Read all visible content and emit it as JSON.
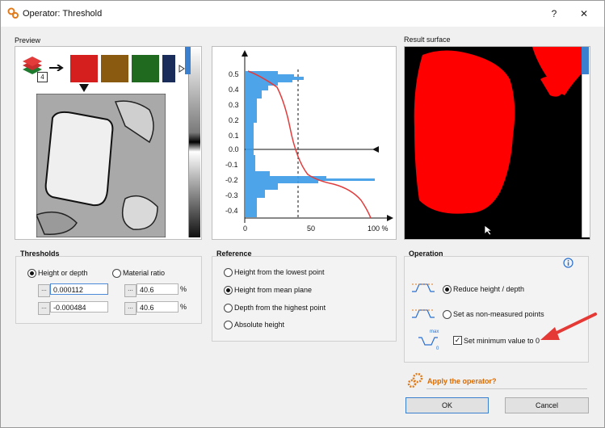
{
  "window": {
    "title": "Operator: Threshold",
    "help_label": "?",
    "close_label": "✕"
  },
  "preview": {
    "label": "Preview",
    "layer_count": "4"
  },
  "result": {
    "label": "Result surface"
  },
  "histogram": {
    "y_ticks": [
      "0.5",
      "0.4",
      "0.3",
      "0.2",
      "0.1",
      "0.0",
      "-0.1",
      "-0.2",
      "-0.3",
      "-0.4"
    ],
    "x_ticks": [
      "0",
      "50",
      "100 %"
    ]
  },
  "thresholds": {
    "title": "Thresholds",
    "option_height": "Height or depth",
    "option_ratio": "Material ratio",
    "upper_value": "0.000112",
    "lower_value": "-0.000484",
    "upper_ratio": "40.6",
    "lower_ratio": "40.6",
    "percent": "%",
    "dots": "..."
  },
  "reference": {
    "title": "Reference",
    "options": [
      "Height from the lowest point",
      "Height from mean plane",
      "Depth from the highest point",
      "Absolute height"
    ],
    "selected": 1
  },
  "operation": {
    "title": "Operation",
    "reduce_label": "Reduce height / depth",
    "nonmeasured_label": "Set as non-measured points",
    "minimum_label": "Set minimum value to 0",
    "icon_max": "max",
    "icon_zero": "0"
  },
  "apply": {
    "label": "Apply the operator?",
    "ok_label": "OK",
    "cancel_label": "Cancel"
  },
  "colors": {
    "accent": "#d96a00",
    "histogram": "#3a9be6",
    "curve": "#e23c3c",
    "result": "#ff0000"
  }
}
